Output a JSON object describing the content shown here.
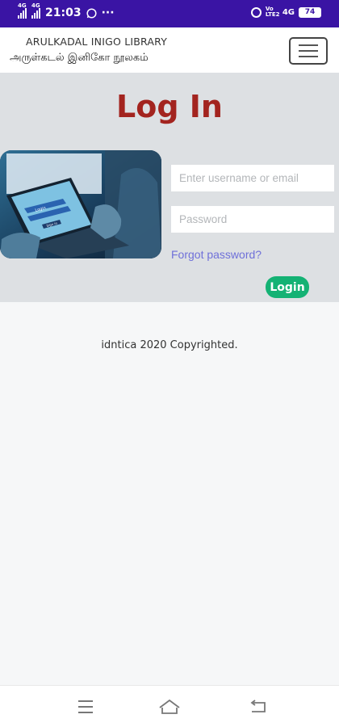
{
  "status_bar": {
    "net1": "4G",
    "net2": "4G",
    "time": "21:03",
    "whatsapp_icon": "whatsapp-icon",
    "more": "···",
    "volte": "Vo LTE2",
    "net3": "4G",
    "battery": "74"
  },
  "header": {
    "brand_en": "ARULKADAL INIGO LIBRARY",
    "brand_ta": "அருள்கடல் இனிகோ நூலகம்",
    "menu_icon": "hamburger-menu-icon"
  },
  "login": {
    "title": "Log In",
    "username_placeholder": "Enter username or email",
    "password_placeholder": "Password",
    "forgot_label": "Forgot password?",
    "login_label": "Login",
    "hero_screen_login": "Login",
    "hero_screen_signin": "Sign in"
  },
  "footer": {
    "copyright": "idntica 2020 Copyrighted."
  },
  "colors": {
    "status_bar": "#3a14a4",
    "title": "#a3241f",
    "login_button": "#14b274",
    "forgot_link": "#6f70d9",
    "login_section_bg": "#dde0e3"
  }
}
